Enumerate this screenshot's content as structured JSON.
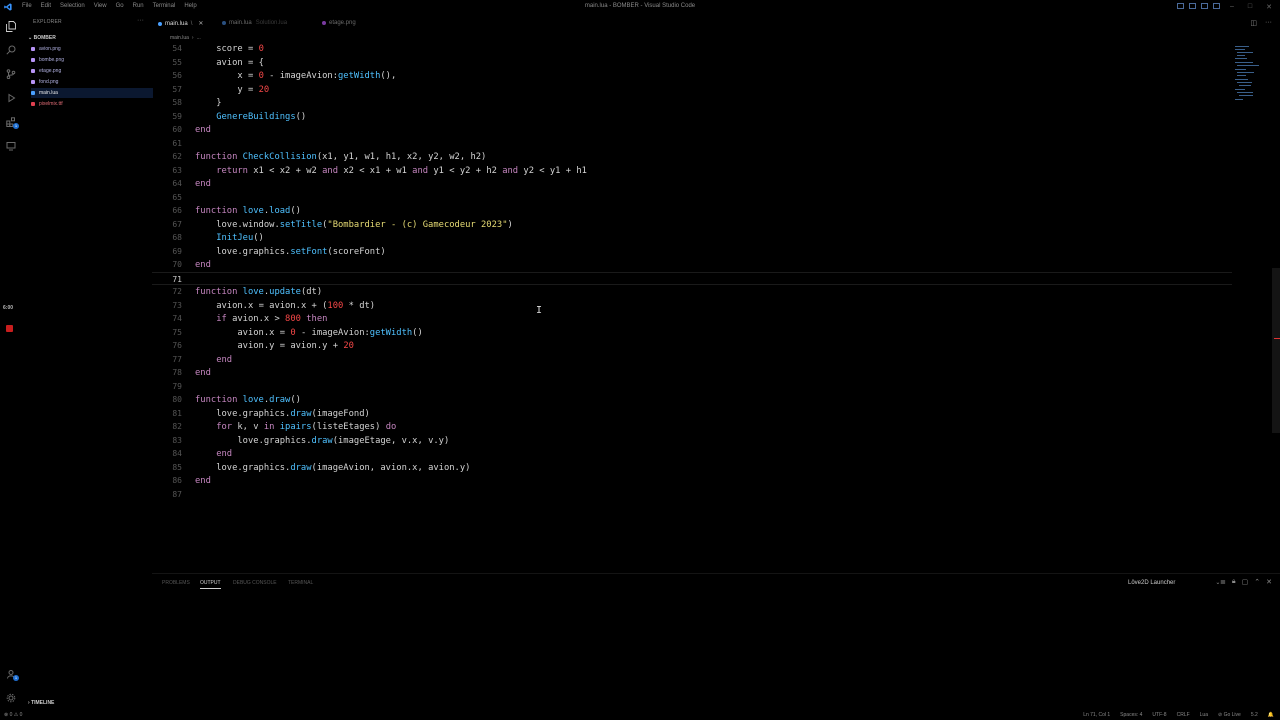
{
  "titlebar": {
    "menu": [
      "File",
      "Edit",
      "Selection",
      "View",
      "Go",
      "Run",
      "Terminal",
      "Help"
    ],
    "window_title": "main.lua - BOMBER - Visual Studio Code",
    "controls": [
      "–",
      "□",
      "✕"
    ]
  },
  "activity": {
    "badge_extensions": "1",
    "badge_accounts": "1"
  },
  "sidebar": {
    "header": "EXPLORER",
    "more": "···",
    "folder": "BOMBER",
    "files": [
      {
        "name": "avion.png",
        "color": "#b794f6"
      },
      {
        "name": "bombe.png",
        "color": "#b794f6"
      },
      {
        "name": "etage.png",
        "color": "#b794f6"
      },
      {
        "name": "fond.png",
        "color": "#b794f6"
      },
      {
        "name": "main.lua",
        "color": "#4aa0ff"
      },
      {
        "name": "pixelmix.ttf",
        "color": "#e04050"
      }
    ],
    "timeline": "TIMELINE",
    "time": "6:00"
  },
  "tabs": [
    {
      "label": "main.lua",
      "suffix": "\\",
      "close": "✕"
    },
    {
      "label": "main.lua",
      "suffix": "",
      "desc": "Solution.lua"
    },
    {
      "label": "etage.png",
      "suffix": "",
      "desc": ""
    }
  ],
  "breadcrumb": [
    "main.lua",
    "..."
  ],
  "editor": {
    "lines": [
      {
        "n": "54",
        "code": "    score = 0"
      },
      {
        "n": "55",
        "code": "    avion = {"
      },
      {
        "n": "56",
        "code": "        x = 0 - imageAvion:getWidth(),"
      },
      {
        "n": "57",
        "code": "        y = 20"
      },
      {
        "n": "58",
        "code": "    }"
      },
      {
        "n": "59",
        "code": "    GenereBuildings()"
      },
      {
        "n": "60",
        "code": "end"
      },
      {
        "n": "61",
        "code": ""
      },
      {
        "n": "62",
        "code": "function CheckCollision(x1, y1, w1, h1, x2, y2, w2, h2)"
      },
      {
        "n": "63",
        "code": "    return x1 < x2 + w2 and x2 < x1 + w1 and y1 < y2 + h2 and y2 < y1 + h1"
      },
      {
        "n": "64",
        "code": "end"
      },
      {
        "n": "65",
        "code": ""
      },
      {
        "n": "66",
        "code": "function love.load()"
      },
      {
        "n": "67",
        "code": "    love.window.setTitle(\"Bombardier - (c) Gamecodeur 2023\")"
      },
      {
        "n": "68",
        "code": "    InitJeu()"
      },
      {
        "n": "69",
        "code": "    love.graphics.setFont(scoreFont)"
      },
      {
        "n": "70",
        "code": "end"
      },
      {
        "n": "71",
        "code": ""
      },
      {
        "n": "72",
        "code": "function love.update(dt)"
      },
      {
        "n": "73",
        "code": "    avion.x = avion.x + (100 * dt)"
      },
      {
        "n": "74",
        "code": "    if avion.x > 800 then"
      },
      {
        "n": "75",
        "code": "        avion.x = 0 - imageAvion:getWidth()"
      },
      {
        "n": "76",
        "code": "        avion.y = avion.y + 20"
      },
      {
        "n": "77",
        "code": "    end"
      },
      {
        "n": "78",
        "code": "end"
      },
      {
        "n": "79",
        "code": ""
      },
      {
        "n": "80",
        "code": "function love.draw()"
      },
      {
        "n": "81",
        "code": "    love.graphics.draw(imageFond)"
      },
      {
        "n": "82",
        "code": "    for k, v in ipairs(listeEtages) do"
      },
      {
        "n": "83",
        "code": "        love.graphics.draw(imageEtage, v.x, v.y)"
      },
      {
        "n": "84",
        "code": "    end"
      },
      {
        "n": "85",
        "code": "    love.graphics.draw(imageAvion, avion.x, avion.y)"
      },
      {
        "n": "86",
        "code": "end"
      },
      {
        "n": "87",
        "code": ""
      }
    ],
    "current_line": "71"
  },
  "panel": {
    "tabs": [
      "PROBLEMS",
      "OUTPUT",
      "DEBUG CONSOLE",
      "TERMINAL"
    ],
    "active_tab": "OUTPUT",
    "output_source": "Löve2D Launcher"
  },
  "statusbar": {
    "left": "⊗ 0 ⚠ 0",
    "items": [
      "Ln 71, Col 1",
      "Spaces: 4",
      "UTF-8",
      "CRLF",
      "Lua",
      "⊘ Go Live",
      "5.2",
      "🔔"
    ]
  },
  "syntax_colors": {
    "keyword": "#c586c0",
    "function_name": "#4fc1ff",
    "string": "#e6db74",
    "number": "#f44747",
    "plain": "#d4d4d4",
    "operator": "#d4d4d4"
  }
}
